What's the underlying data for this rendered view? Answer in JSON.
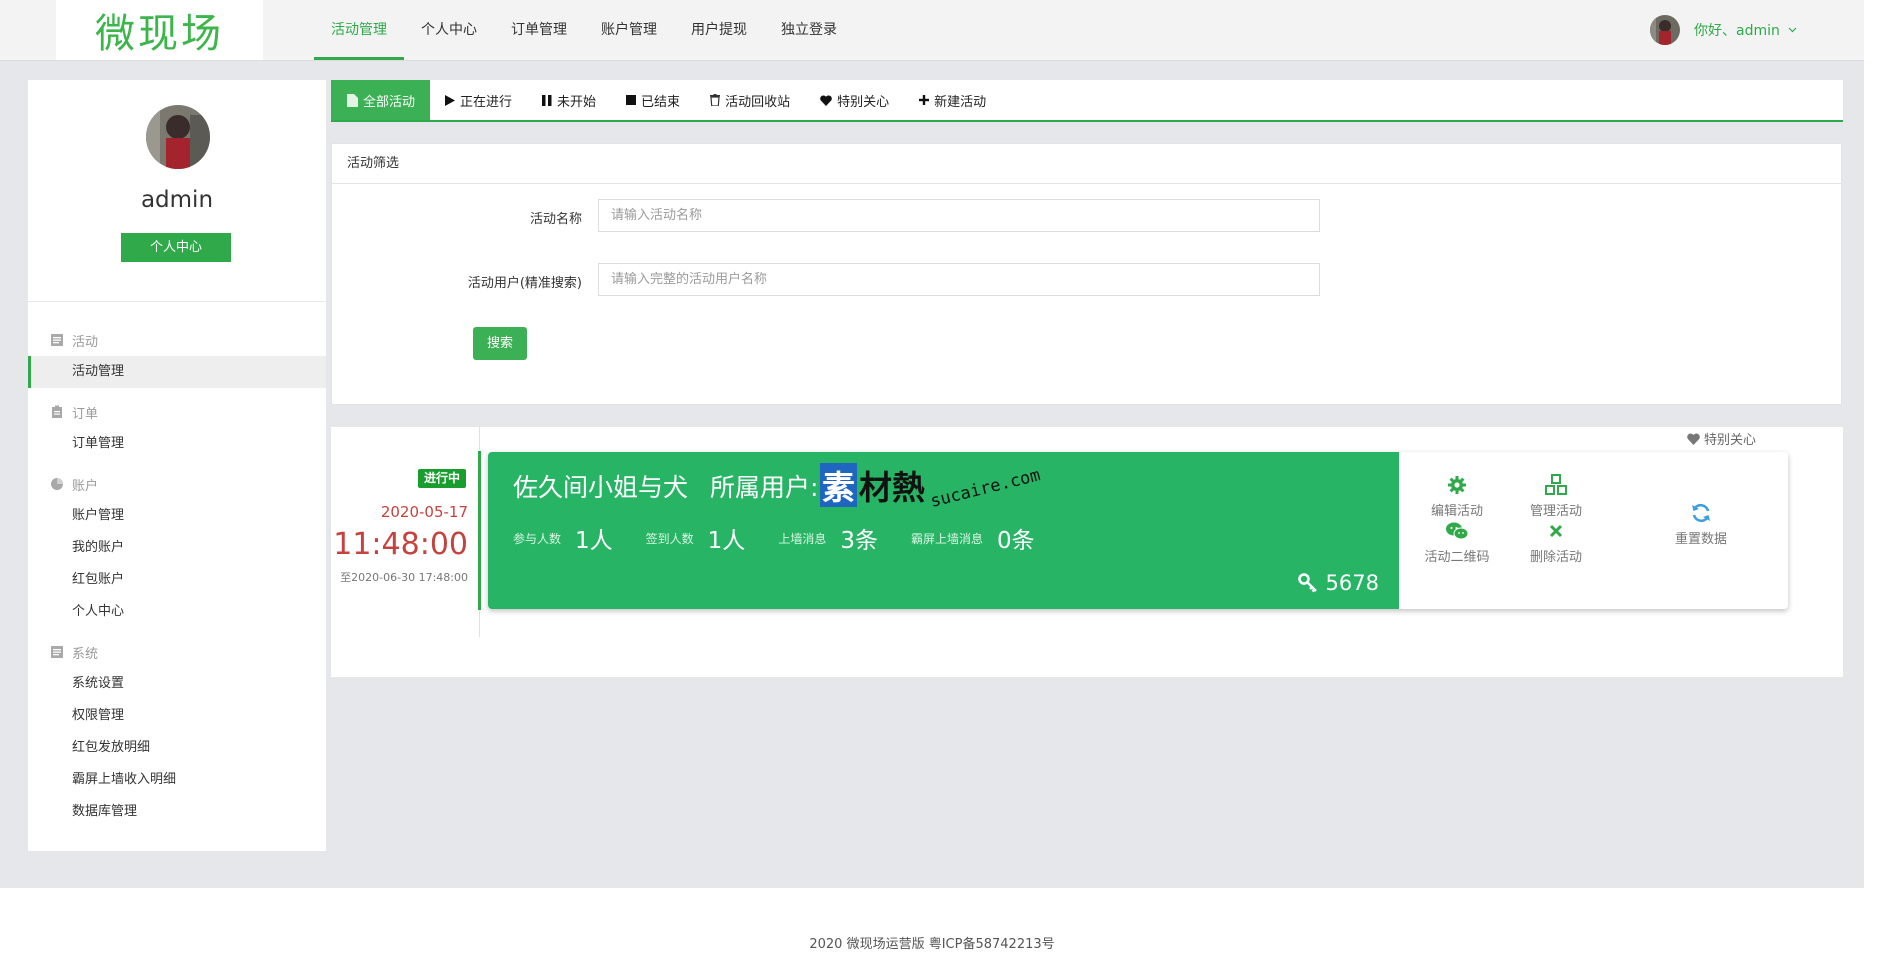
{
  "app": {
    "logo_text": "微现场"
  },
  "topnav": {
    "items": [
      "活动管理",
      "个人中心",
      "订单管理",
      "账户管理",
      "用户提现",
      "独立登录"
    ],
    "active_index": 0
  },
  "user": {
    "greeting": "你好、admin"
  },
  "sidebar": {
    "profile_name": "admin",
    "profile_button": "个人中心",
    "sections": [
      {
        "title": "活动",
        "icon": "document-icon",
        "items": [
          "活动管理"
        ]
      },
      {
        "title": "订单",
        "icon": "clipboard-icon",
        "items": [
          "订单管理"
        ]
      },
      {
        "title": "账户",
        "icon": "pie-chart-icon",
        "items": [
          "账户管理",
          "我的账户",
          "红包账户",
          "个人中心"
        ]
      },
      {
        "title": "系统",
        "icon": "document-icon",
        "items": [
          "系统设置",
          "权限管理",
          "红包发放明细",
          "霸屏上墙收入明细",
          "数据库管理"
        ]
      }
    ],
    "active_item": "活动管理"
  },
  "tabs": {
    "items": [
      {
        "label": "全部活动",
        "icon": "file-icon"
      },
      {
        "label": "正在进行",
        "icon": "play-icon"
      },
      {
        "label": "未开始",
        "icon": "pause-icon"
      },
      {
        "label": "已结束",
        "icon": "stop-icon"
      },
      {
        "label": "活动回收站",
        "icon": "trash-icon"
      },
      {
        "label": "特别关心",
        "icon": "heart-icon"
      },
      {
        "label": "新建活动",
        "icon": "plus-icon"
      }
    ],
    "active_index": 0
  },
  "filter": {
    "title": "活动筛选",
    "name_label": "活动名称",
    "name_placeholder": "请输入活动名称",
    "name_value": "",
    "user_label": "活动用户(精准搜索)",
    "user_placeholder": "请输入完整的活动用户名称",
    "user_value": "",
    "search_button": "搜索"
  },
  "activity": {
    "favorite_label": "特别关心",
    "status": "进行中",
    "date": "2020-05-17",
    "time": "11:48:00",
    "end": "至2020-06-30 17:48:00",
    "title": "佐久间小姐与犬",
    "owner_prefix": "所属用户:",
    "stats": [
      {
        "label": "参与人数",
        "value": "1人"
      },
      {
        "label": "签到人数",
        "value": "1人"
      },
      {
        "label": "上墙消息",
        "value": "3条"
      },
      {
        "label": "霸屏上墙消息",
        "value": "0条"
      }
    ],
    "key_code": "5678",
    "actions": {
      "edit": "编辑活动",
      "manage": "管理活动",
      "qrcode": "活动二维码",
      "delete": "删除活动",
      "reset": "重置数据"
    }
  },
  "watermark": {
    "big": "素材熱",
    "url": "sucaire.com"
  },
  "footer": {
    "text": "2020 微现场运营版 粤ICP备58742213号"
  },
  "colors": {
    "brand_green": "#2fa94a",
    "card_green": "#27b565",
    "accent_red": "#c6423f"
  }
}
